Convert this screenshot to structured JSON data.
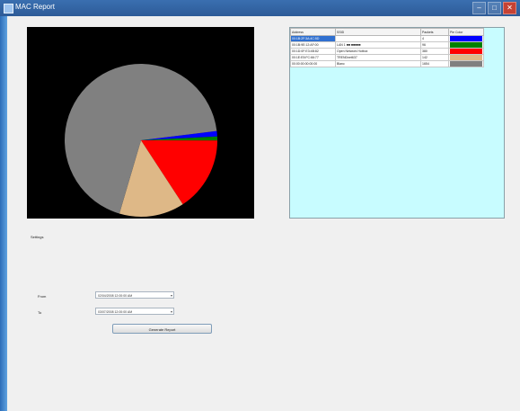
{
  "window": {
    "title": "MAC Report",
    "min_label": "–",
    "max_label": "□",
    "close_label": "✕"
  },
  "grid": {
    "columns": [
      "Address",
      "SSID",
      "Packets",
      "Pie Color"
    ],
    "rows": [
      {
        "address": "00:1B:2F:3A:4C:5D",
        "ssid": "",
        "packets": "4",
        "color": "#0000ff",
        "selected": true
      },
      {
        "address": "00:1B:9E:12:AF:00",
        "ssid": "LAN 1 ■■ ■■■■■",
        "packets": "96",
        "color": "#008000",
        "selected": false
      },
      {
        "address": "00:1D:0F:E3:4B:82",
        "ssid": "Open Network Hotbox",
        "packets": "380",
        "color": "#ff0000",
        "selected": false
      },
      {
        "address": "00:1E:E5:FC:66:77",
        "ssid": "TRENDnet637",
        "packets": "142",
        "color": "#deb887",
        "selected": false
      },
      {
        "address": "00:00:00:00:00:00",
        "ssid": "Blanc",
        "packets": "1654",
        "color": "#808080",
        "selected": false
      }
    ]
  },
  "settings_label": "Settings",
  "from": {
    "label": "From",
    "value": "02/04/2008 12:00:00 AM"
  },
  "to": {
    "label": "To",
    "value": "03/07/2008 12:00:00 AM"
  },
  "generate_label": "Generate Report",
  "chart_data": {
    "type": "pie",
    "labels": [
      "00:1B:2F:3A:4C:5D",
      "00:1B:9E:12:AF:00",
      "00:1D:0F:E3:4B:82",
      "00:1E:E5:FC:66:77",
      "00:00:00:00:00:00"
    ],
    "values": [
      28,
      20,
      380,
      333,
      1654
    ],
    "colors": [
      "#0000ff",
      "#008000",
      "#ff0000",
      "#deb887",
      "#808080"
    ],
    "start_angle_deg": -7,
    "direction": "clockwise"
  }
}
